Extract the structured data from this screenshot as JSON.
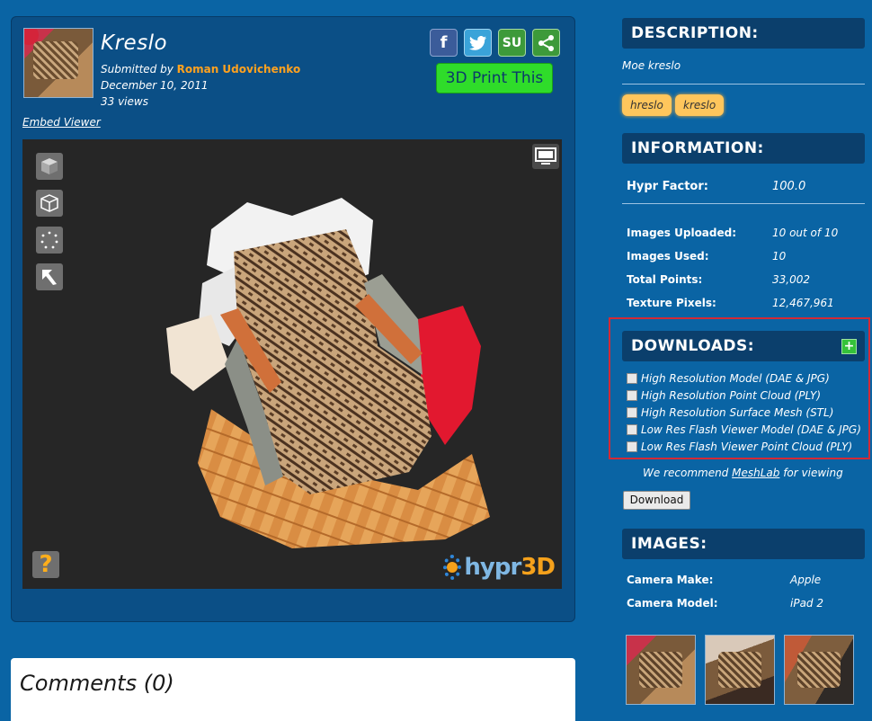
{
  "model": {
    "title": "Kreslo",
    "submitted_prefix": "Submitted by ",
    "author": "Roman Udovichenko",
    "date": "December 10, 2011",
    "views": "33 views",
    "embed_label": "Embed Viewer",
    "print_label": "3D Print This",
    "share": {
      "facebook": "f",
      "stumble": "SU"
    }
  },
  "viewer": {
    "help_glyph": "?",
    "logo_text_a": "hypr",
    "logo_text_b": "3D"
  },
  "comments": {
    "title": "Comments (0)"
  },
  "description": {
    "heading": "DESCRIPTION:",
    "text": "Moe kreslo",
    "tags": [
      "hreslo",
      "kreslo"
    ]
  },
  "information": {
    "heading": "INFORMATION:",
    "hypr_factor_label": "Hypr Factor:",
    "hypr_factor_value": "100.0",
    "rows": [
      {
        "label": "Images Uploaded:",
        "value": "10 out of 10"
      },
      {
        "label": "Images Used:",
        "value": "10"
      },
      {
        "label": "Total Points:",
        "value": "33,002"
      },
      {
        "label": "Texture Pixels:",
        "value": "12,467,961"
      }
    ]
  },
  "downloads": {
    "heading": "DOWNLOADS:",
    "plus": "+",
    "items": [
      "High Resolution Model (DAE & JPG)",
      "High Resolution Point Cloud (PLY)",
      "High Resolution Surface Mesh (STL)",
      "Low Res Flash Viewer Model (DAE & JPG)",
      "Low Res Flash Viewer Point Cloud (PLY)"
    ],
    "recommend_prefix": "We recommend ",
    "recommend_link": "MeshLab",
    "recommend_suffix": " for viewing",
    "button": "Download"
  },
  "images": {
    "heading": "IMAGES:",
    "rows": [
      {
        "label": "Camera Make:",
        "value": "Apple"
      },
      {
        "label": "Camera Model:",
        "value": "iPad 2"
      }
    ]
  },
  "colors": {
    "page_bg": "#0a64a4",
    "panel_bg": "#0b4f86",
    "section_head": "#0b3f6c",
    "author": "#ffa21f",
    "print_button": "#2fdc2a",
    "tag": "#ffc65c",
    "highlight_border": "#d32a36"
  }
}
